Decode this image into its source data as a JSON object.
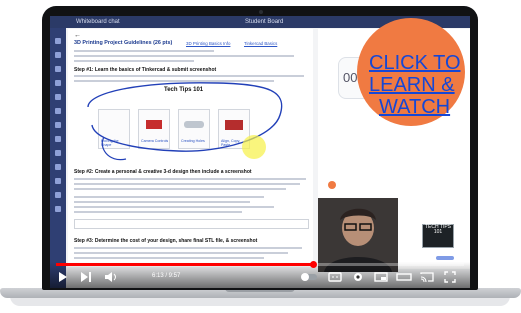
{
  "doc": {
    "app_title": "Whiteboard chat",
    "board_title": "Student Board",
    "heading": "3D Printing Project Guidelines (26 pts)",
    "tab1": "3D Printing Basics Info",
    "tab2": "Tinkercad Basics",
    "step1": "Step #1:  Learn the basics of Tinkercad & submit screenshot",
    "step2": "Step #2:  Create a personal & creative 3-d design then include a screenshot",
    "step3": "Step #3:  Determine the cost of your design, share final STL file, & screenshot",
    "cards": [
      "Moving the Shape",
      "Camera Controls",
      "Creating Holes",
      "Align, Copy, Paste"
    ],
    "annotation": "Tech Tips 101"
  },
  "panel": {
    "timer": "00:0"
  },
  "cta": {
    "line1": "CLICK TO",
    "line2": "LEARN &",
    "line3": "WATCH"
  },
  "player": {
    "time": "6:13 / 9:57",
    "progress": 0.63,
    "controls": [
      "play-icon",
      "next-icon",
      "volume-icon",
      "autoplay-toggle",
      "captions-icon",
      "settings-gear-icon",
      "miniplayer-icon",
      "theater-icon",
      "cast-icon",
      "fullscreen-icon"
    ]
  },
  "logo": {
    "text": "TECH TIPS 101"
  },
  "colors": {
    "accent": "#f07a42",
    "link": "#1547d6",
    "progress": "#ff0000",
    "topbar": "#2b3a67"
  }
}
